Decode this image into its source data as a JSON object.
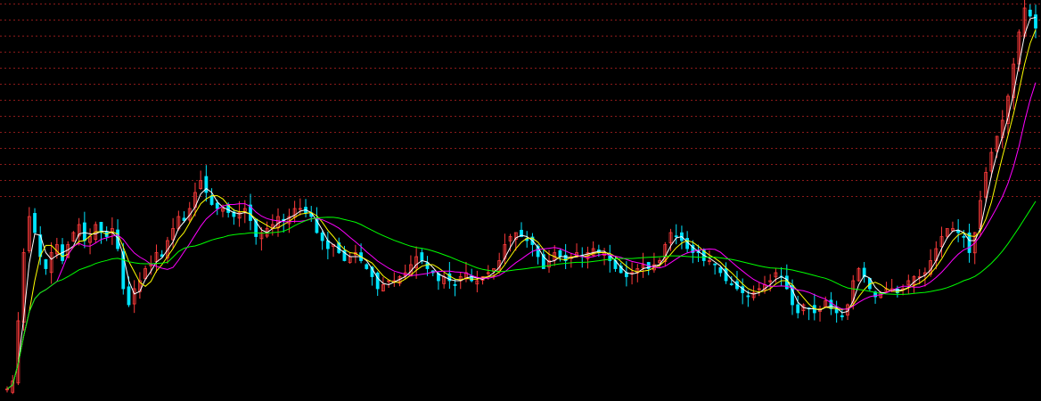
{
  "chart_data": {
    "type": "candlestick",
    "title": "",
    "xlabel": "",
    "ylabel": "",
    "grid": true,
    "ylim": [
      0,
      100
    ],
    "colors": {
      "background": "#000000",
      "grid": "#8b1a1a",
      "up": "#ff3b3b",
      "down": "#00e5ff",
      "ma_short": "#ffffff",
      "ma_mid": "#ffff00",
      "ma_long": "#ff00ff",
      "ma_longest": "#00ff00"
    },
    "close": [
      3.0,
      5.0,
      20.0,
      37.0,
      46.0,
      42.0,
      36.0,
      33.0,
      37.0,
      39.0,
      35.0,
      39.0,
      42.0,
      44.0,
      40.0,
      41.0,
      44.0,
      42.0,
      41.0,
      43.0,
      38.0,
      28.0,
      24.0,
      28.0,
      30.0,
      33.0,
      34.0,
      37.0,
      36.0,
      40.0,
      43.0,
      46.0,
      45.0,
      48.0,
      52.0,
      55.0,
      52.0,
      49.0,
      48.0,
      48.0,
      47.0,
      46.0,
      47.0,
      48.0,
      45.0,
      41.0,
      42.0,
      43.0,
      44.0,
      46.0,
      45.0,
      46.0,
      48.0,
      48.0,
      47.0,
      46.0,
      42.0,
      40.0,
      38.0,
      39.0,
      37.0,
      35.0,
      36.0,
      37.0,
      35.0,
      33.0,
      31.0,
      28.0,
      29.0,
      30.0,
      30.0,
      31.0,
      32.0,
      34.0,
      36.0,
      35.0,
      33.0,
      32.0,
      30.0,
      31.0,
      30.0,
      29.0,
      31.0,
      32.0,
      30.0,
      30.0,
      31.0,
      32.0,
      33.0,
      35.0,
      39.0,
      41.0,
      42.0,
      41.0,
      40.0,
      39.0,
      36.0,
      33.0,
      35.0,
      37.0,
      36.0,
      35.0,
      36.0,
      37.0,
      36.0,
      37.0,
      38.0,
      37.0,
      37.0,
      35.0,
      33.0,
      32.0,
      31.0,
      32.0,
      33.0,
      34.0,
      33.0,
      34.0,
      35.0,
      39.0,
      42.0,
      41.0,
      40.0,
      38.0,
      37.0,
      37.0,
      35.0,
      35.0,
      34.0,
      32.0,
      30.0,
      29.0,
      28.0,
      27.0,
      26.0,
      27.0,
      28.0,
      29.0,
      30.0,
      32.0,
      31.0,
      28.0,
      24.0,
      22.0,
      24.0,
      23.0,
      22.0,
      23.0,
      25.0,
      23.0,
      22.0,
      21.0,
      24.0,
      30.0,
      33.0,
      31.0,
      28.0,
      26.0,
      27.0,
      28.0,
      28.0,
      27.0,
      28.0,
      30.0,
      31.0,
      31.0,
      32.0,
      35.0,
      38.0,
      41.0,
      43.0,
      43.0,
      42.0,
      41.0,
      37.0,
      42.0,
      50.0,
      57.0,
      62.0,
      66.0,
      70.0,
      76.0,
      84.0,
      92.0,
      98.0,
      96.0,
      93.0
    ],
    "overlays": [
      {
        "kind": "moving_average",
        "period": 3,
        "color": "#ffffff"
      },
      {
        "kind": "moving_average",
        "period": 5,
        "color": "#ffff00"
      },
      {
        "kind": "moving_average",
        "period": 10,
        "color": "#ff00ff"
      },
      {
        "kind": "moving_average",
        "period": 30,
        "color": "#00ff00"
      }
    ]
  }
}
